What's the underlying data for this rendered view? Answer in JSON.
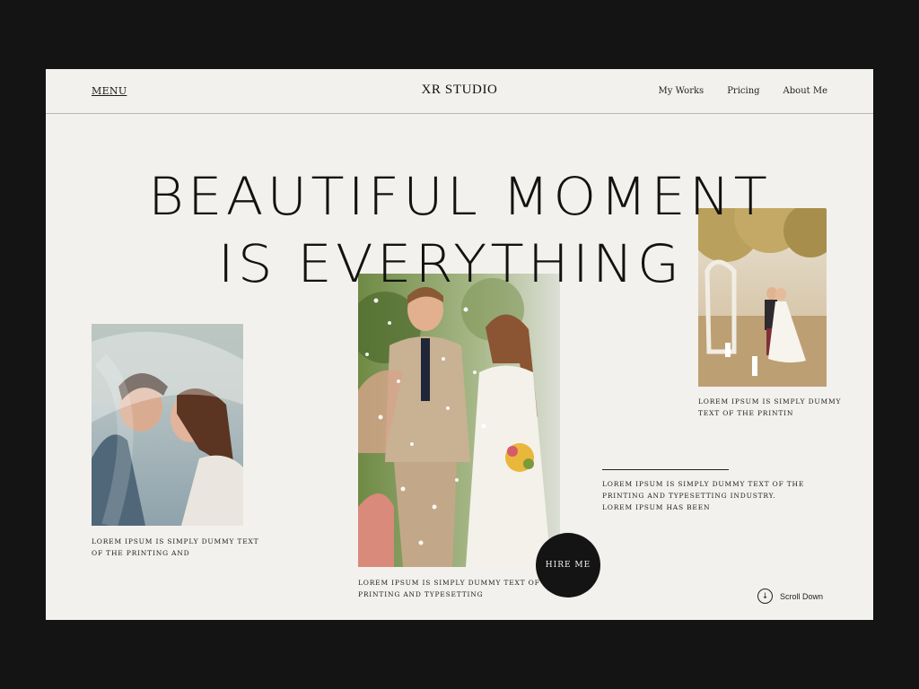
{
  "nav": {
    "menu_label": "MENU",
    "brand": "XR STUDIO",
    "links": [
      "My Works",
      "Pricing",
      "About Me"
    ]
  },
  "hero": {
    "line1": "BEAUTIFUL MOMENT",
    "line2": "IS EVERYTHING"
  },
  "photos": {
    "left": {
      "caption_line1": "LOREM IPSUM IS SIMPLY DUMMY TEXT",
      "caption_line2": "OF THE PRINTING AND"
    },
    "center": {
      "caption_line1": "LOREM IPSUM IS SIMPLY DUMMY TEXT OF THE",
      "caption_line2": "PRINTING AND TYPESETTING"
    },
    "right": {
      "caption_line1": "LOREM IPSUM IS SIMPLY DUMMY",
      "caption_line2": "TEXT OF THE PRINTIN"
    }
  },
  "side_text": {
    "line1": "LOREM IPSUM IS SIMPLY DUMMY TEXT OF THE",
    "line2": "PRINTING AND TYPESETTING INDUSTRY.",
    "line3": "LOREM IPSUM HAS BEEN"
  },
  "cta": {
    "hire_label": "HIRE ME"
  },
  "scroll": {
    "label": "Scroll Down",
    "icon": "arrow-down-icon"
  },
  "colors": {
    "background": "#141414",
    "page": "#f3f1ed",
    "text": "#121212"
  }
}
